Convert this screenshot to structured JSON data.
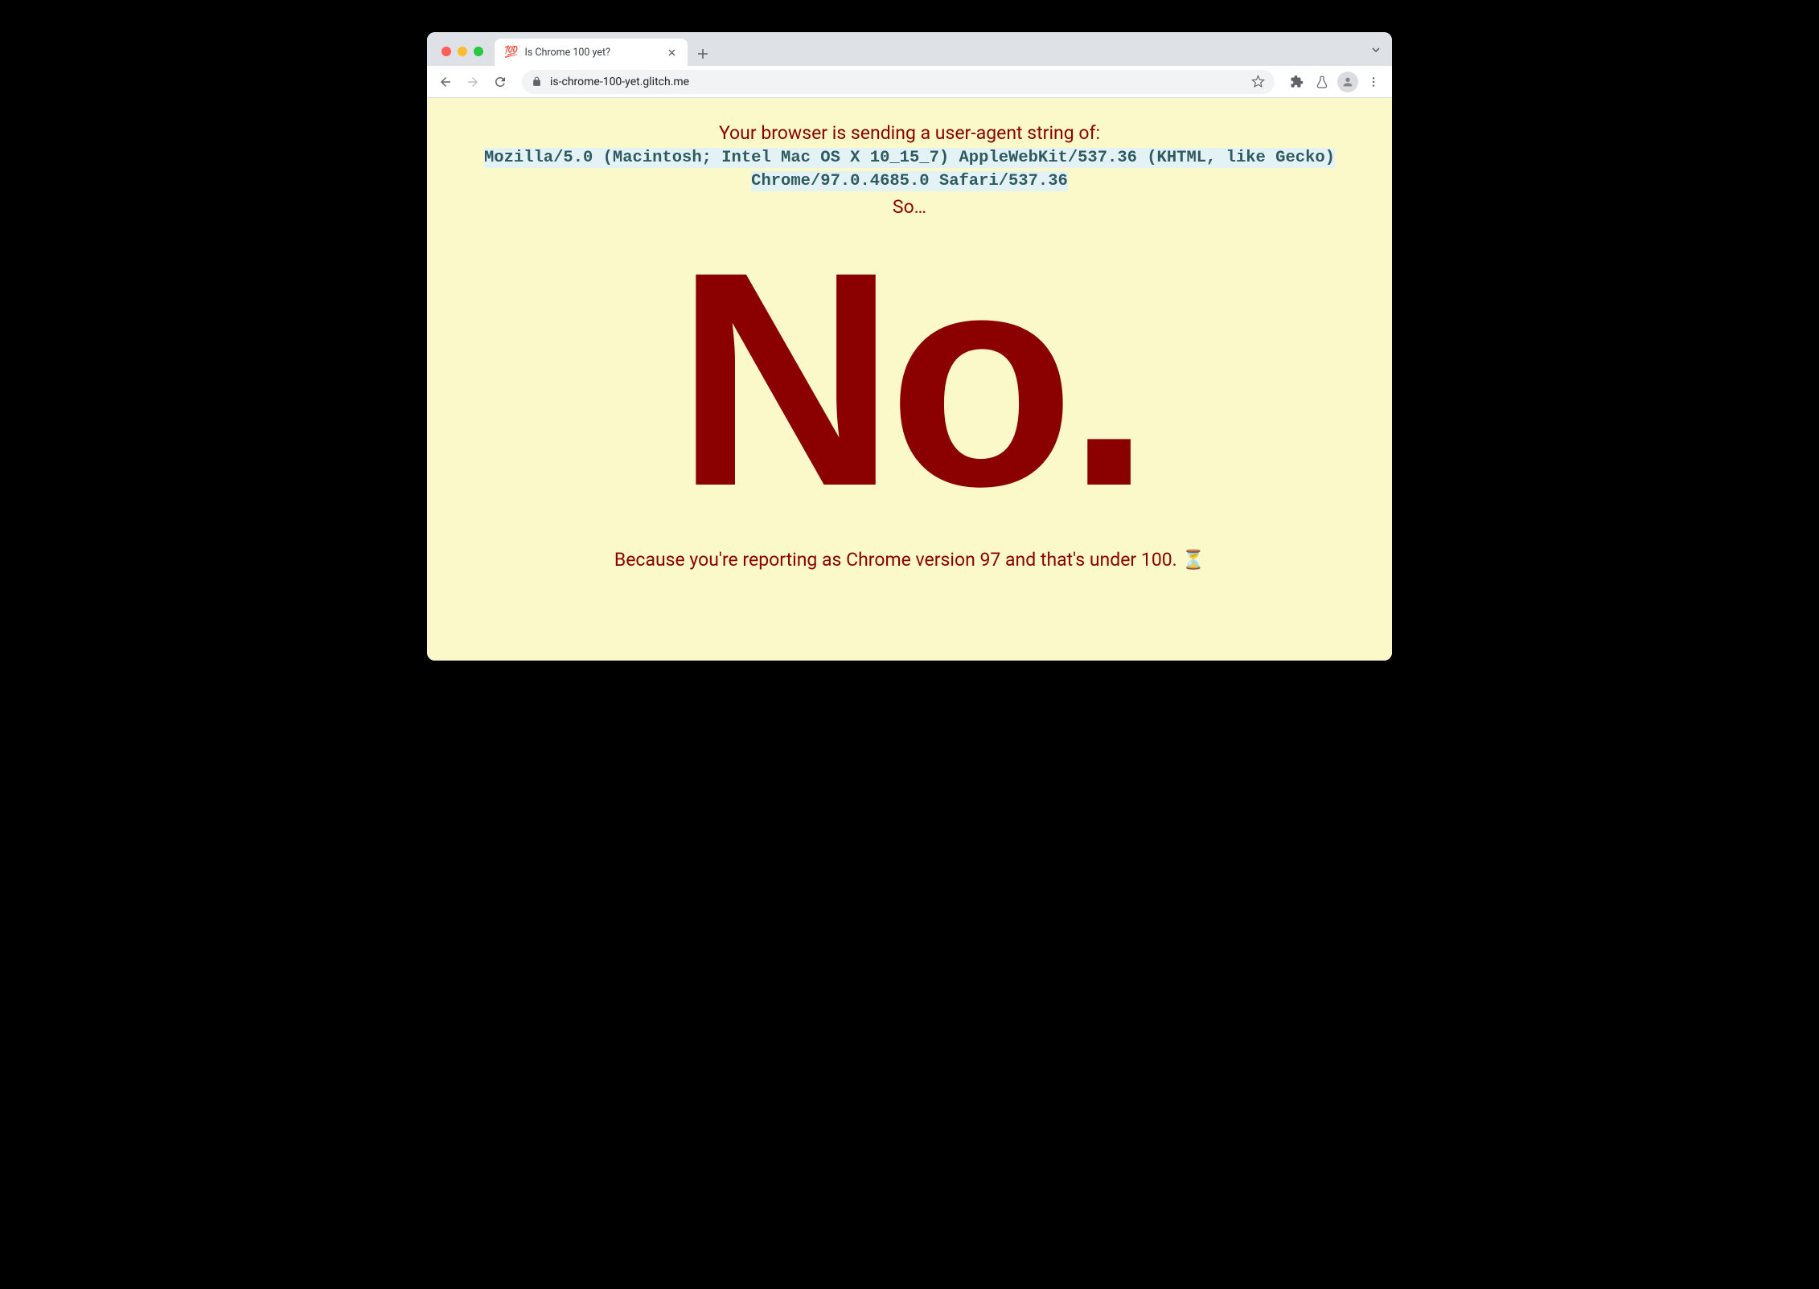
{
  "tab": {
    "favicon": "💯",
    "title": "Is Chrome 100 yet?"
  },
  "address": {
    "url": "is-chrome-100-yet.glitch.me"
  },
  "page": {
    "intro": "Your browser is sending a user-agent string of:",
    "user_agent": "Mozilla/5.0 (Macintosh; Intel Mac OS X 10_15_7) AppleWebKit/537.36 (KHTML, like Gecko) Chrome/97.0.4685.0 Safari/537.36",
    "so": "So…",
    "answer": "No.",
    "reason": "Because you're reporting as Chrome version 97 and that's under 100. ⏳"
  }
}
